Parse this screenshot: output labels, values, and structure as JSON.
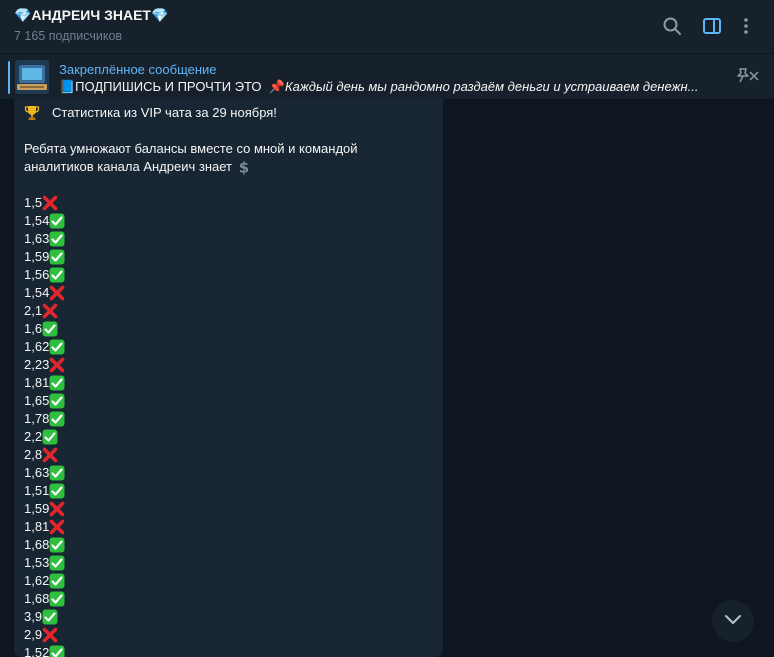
{
  "header": {
    "title": "💎АНДРЕИЧ ЗНАЕТ💎",
    "subscribers": "7 165 подписчиков",
    "icons": [
      "search-icon",
      "sidebar-toggle-icon",
      "more-icon"
    ]
  },
  "pinned": {
    "label": "Закреплённое сообщение",
    "text_main": "📘ПОДПИШИСЬ И ПРОЧТИ ЭТО",
    "text_pin_emoji": "📌",
    "text_italic": "Каждый день мы рандомно раздаём деньги и устраиваем денежн..."
  },
  "message": {
    "stats_header": "Статистика  из VIP чата за 29 ноября!",
    "intro_line1": "Ребята умножают балансы вместе со мной и командой",
    "intro_line2": "аналитиков канала Андреич знает",
    "results": [
      {
        "value": "1,5",
        "win": false
      },
      {
        "value": "1,54",
        "win": true
      },
      {
        "value": "1,63",
        "win": true
      },
      {
        "value": "1,59",
        "win": true
      },
      {
        "value": "1,56",
        "win": true
      },
      {
        "value": "1,54",
        "win": false
      },
      {
        "value": "2,1",
        "win": false
      },
      {
        "value": "1,6",
        "win": true
      },
      {
        "value": "1,62",
        "win": true
      },
      {
        "value": "2,23",
        "win": false
      },
      {
        "value": "1,81",
        "win": true
      },
      {
        "value": "1,65",
        "win": true
      },
      {
        "value": "1,78",
        "win": true
      },
      {
        "value": "2,2",
        "win": true
      },
      {
        "value": "2,8",
        "win": false
      },
      {
        "value": "1,63",
        "win": true
      },
      {
        "value": "1,51",
        "win": true
      },
      {
        "value": "1,59",
        "win": false
      },
      {
        "value": "1,81",
        "win": false
      },
      {
        "value": "1,68",
        "win": true
      },
      {
        "value": "1,53",
        "win": true
      },
      {
        "value": "1,62",
        "win": true
      },
      {
        "value": "1,68",
        "win": true
      },
      {
        "value": "3,9",
        "win": true
      },
      {
        "value": "2,9",
        "win": false
      },
      {
        "value": "1,52",
        "win": true
      }
    ]
  },
  "colors": {
    "background": "#0e1621",
    "header": "#17212b",
    "bubble": "#182533",
    "accent": "#5eb5f7",
    "win": "#2dbf3d",
    "loss": "#e0262c"
  }
}
